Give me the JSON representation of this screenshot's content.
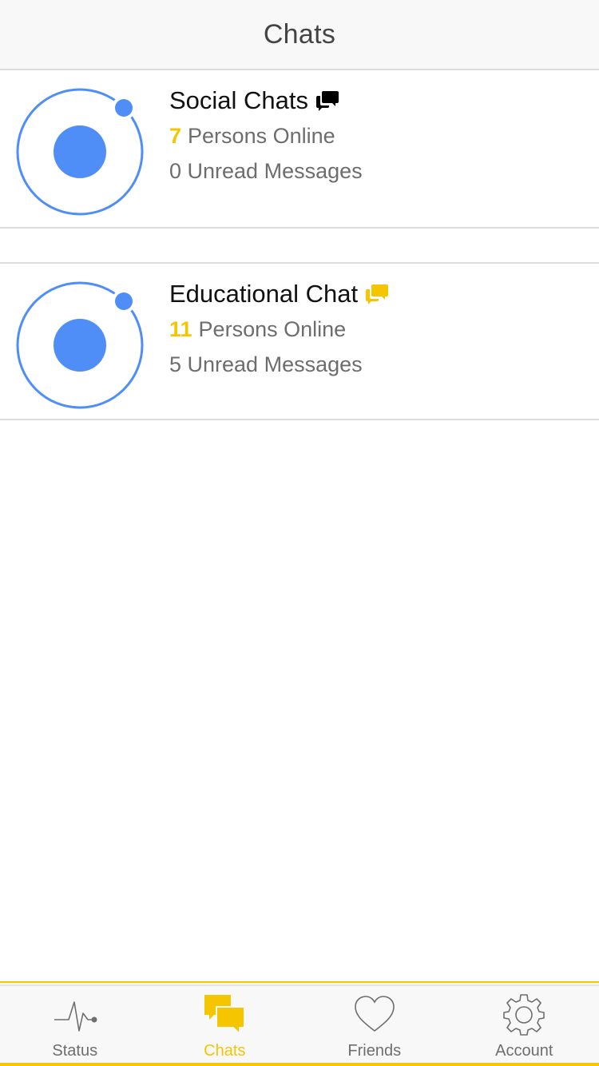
{
  "header": {
    "title": "Chats"
  },
  "chats": [
    {
      "title": "Social Chats",
      "title_icon": "chat-bubbles-icon",
      "title_icon_color": "#000000",
      "online_count": "7",
      "online_label": "Persons Online",
      "unread": "0 Unread Messages"
    },
    {
      "title": "Educational Chat",
      "title_icon": "chat-bubbles-icon",
      "title_icon_color": "#f5c500",
      "online_count": "11",
      "online_label": "Persons Online",
      "unread": "5 Unread Messages"
    }
  ],
  "tabs": [
    {
      "label": "Status",
      "icon": "pulse-icon",
      "active": false
    },
    {
      "label": "Chats",
      "icon": "chat-bubbles-icon",
      "active": true
    },
    {
      "label": "Friends",
      "icon": "heart-icon",
      "active": false
    },
    {
      "label": "Account",
      "icon": "gear-icon",
      "active": false
    }
  ],
  "colors": {
    "accent": "#f5c500",
    "avatar_blue": "#4f8ef7",
    "header_bg": "#f8f8f8"
  }
}
